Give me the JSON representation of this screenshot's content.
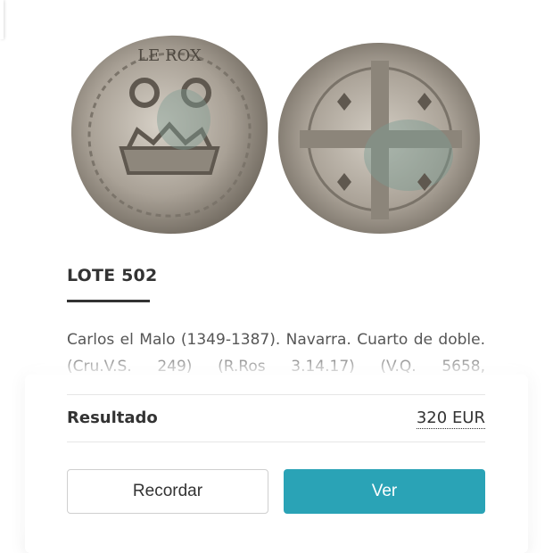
{
  "lot": {
    "title": "LOTE 502"
  },
  "description": "Carlos el Malo (1349-1387). Navarra. Cuarto de doble. (Cru.V.S. 249) (R.Ros 3.14.17) (V.Q. 5658,",
  "result": {
    "label": "Resultado",
    "value": "320 EUR"
  },
  "buttons": {
    "recordar": "Recordar",
    "ver": "Ver"
  },
  "colors": {
    "accent": "#2aa3b6",
    "text": "#333333",
    "coin_silver": "#b9b2a6"
  },
  "images": {
    "obverse": "coin-obverse-image",
    "reverse": "coin-reverse-image"
  }
}
